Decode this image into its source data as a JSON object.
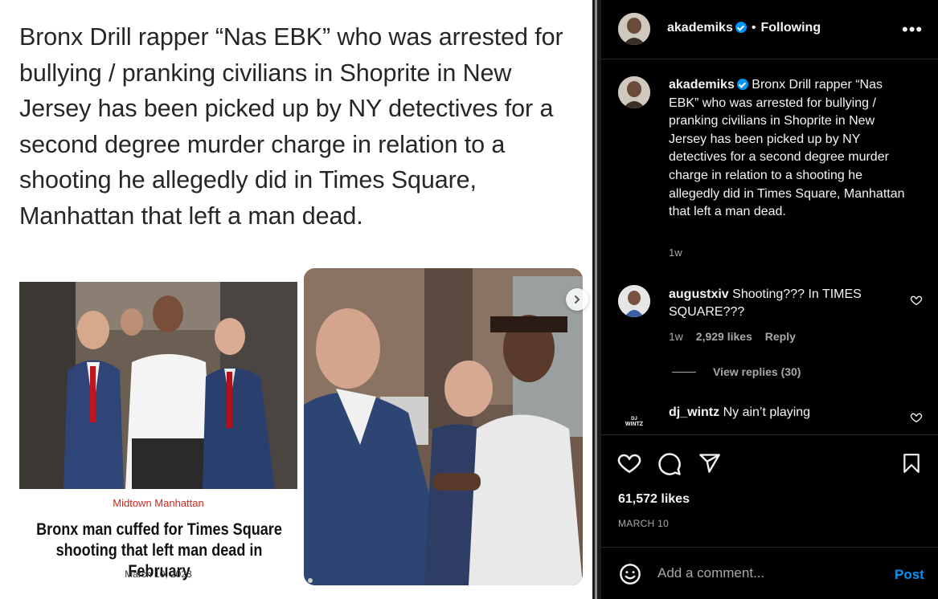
{
  "media": {
    "headline": "Bronx Drill rapper “Nas EBK” who was arrested for bullying / pranking civilians in Shoprite in New Jersey has been picked up by NY detectives for a second degree murder charge in relation to a shooting he allegedly did in Times Square, Manhattan that left a man dead.",
    "card": {
      "section": "Midtown Manhattan",
      "title": "Bronx man cuffed for Times Square shooting that left man dead in February",
      "date": "March 10, 2023"
    },
    "icons": {
      "next": "chevron-right-icon"
    }
  },
  "post": {
    "author": "akademiks",
    "follow_status": "Following",
    "more": "•••",
    "caption": "Bronx Drill rapper “Nas EBK” who was arrested for bullying / pranking civilians in Shoprite in New Jersey has been picked up by NY detectives for a second degree murder charge in relation to a shooting he allegedly did in Times Square, Manhattan that left a man dead.",
    "caption_time": "1w",
    "comments": [
      {
        "user": "augustxiv",
        "text": "Shooting??? In TIMES SQUARE???",
        "time": "1w",
        "likes": "2,929 likes",
        "reply": "Reply",
        "view_replies": "View replies (30)"
      },
      {
        "user": "dj_wintz",
        "text": "Ny ain’t playing",
        "avatar_text": "DJ WINTZ"
      }
    ],
    "likes": "61,572 likes",
    "date": "MARCH 10",
    "add_comment_placeholder": "Add a comment...",
    "post_label": "Post",
    "colors": {
      "accent": "#0095f6",
      "background": "#000000",
      "muted": "#a8a8a8"
    }
  }
}
